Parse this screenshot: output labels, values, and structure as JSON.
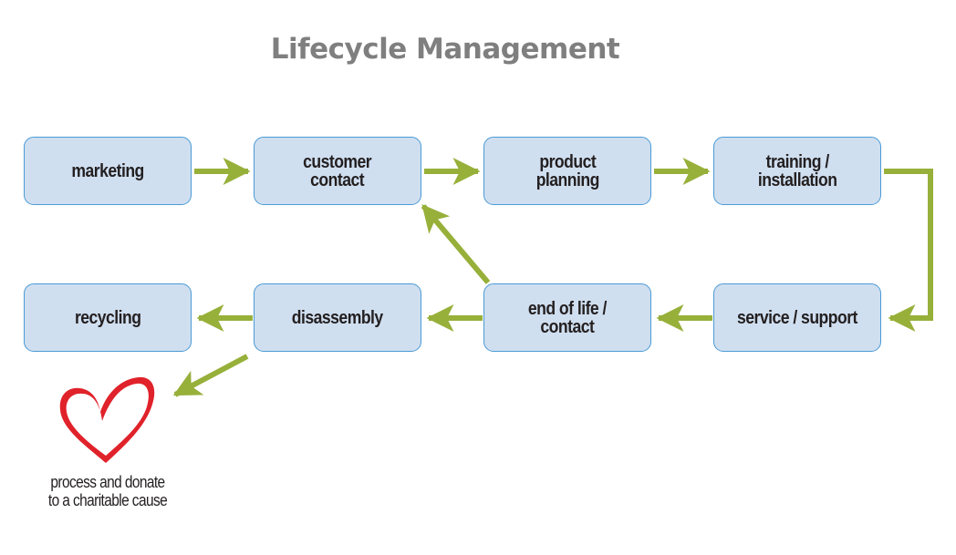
{
  "title": "Lifecycle Management",
  "colors": {
    "box_fill": "#d0dff0",
    "box_border": "#4a9ad6",
    "arrow": "#97b03a",
    "heart": "#e0222a",
    "title": "#7f7f7f"
  },
  "nodes": [
    {
      "id": "marketing",
      "label": "marketing"
    },
    {
      "id": "customer-contact",
      "label": "customer\ncontact"
    },
    {
      "id": "product-planning",
      "label": "product\nplanning"
    },
    {
      "id": "training-installation",
      "label": "training /\ninstallation"
    },
    {
      "id": "recycling",
      "label": "recycling"
    },
    {
      "id": "disassembly",
      "label": "disassembly"
    },
    {
      "id": "end-of-life-contact",
      "label": "end of life /\ncontact"
    },
    {
      "id": "service-support",
      "label": "service / support"
    }
  ],
  "edges": [
    {
      "from": "marketing",
      "to": "customer-contact"
    },
    {
      "from": "customer-contact",
      "to": "product-planning"
    },
    {
      "from": "product-planning",
      "to": "training-installation"
    },
    {
      "from": "training-installation",
      "to": "service-support"
    },
    {
      "from": "service-support",
      "to": "end-of-life-contact"
    },
    {
      "from": "end-of-life-contact",
      "to": "disassembly"
    },
    {
      "from": "end-of-life-contact",
      "to": "customer-contact"
    },
    {
      "from": "disassembly",
      "to": "recycling"
    },
    {
      "from": "disassembly",
      "to": "donate"
    }
  ],
  "donate": {
    "icon": "heart-icon",
    "caption": "process and donate\nto a charitable cause"
  }
}
